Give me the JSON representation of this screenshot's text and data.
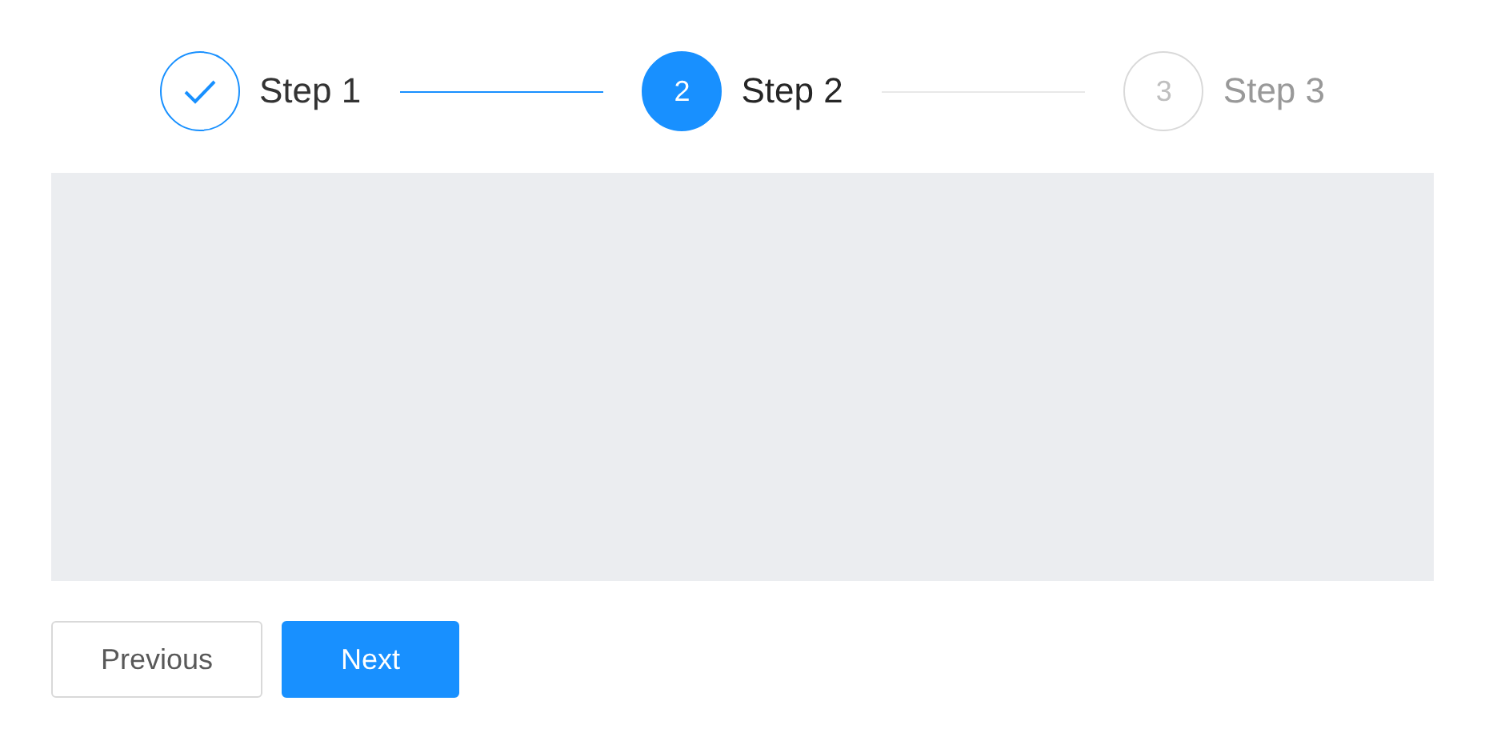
{
  "steps": [
    {
      "title": "Step 1",
      "completed": true,
      "selected": false
    },
    {
      "title": "Step 2",
      "completed": false,
      "selected": true,
      "number": "2"
    },
    {
      "title": "Step 3",
      "completed": false,
      "selected": false,
      "number": "3"
    }
  ],
  "buttons": [
    {
      "label": "Previous",
      "kind": "default"
    },
    {
      "label": "Next",
      "kind": "primary"
    }
  ]
}
